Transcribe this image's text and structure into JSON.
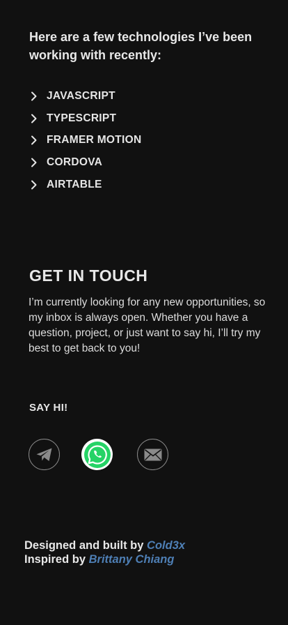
{
  "about": {
    "intro": "Here are a few technologies I’ve been working with recently:",
    "technologies": [
      "JAVASCRIPT",
      "TYPESCRIPT",
      "FRAMER MOTION",
      "CORDOVA",
      "AIRTABLE"
    ]
  },
  "contact": {
    "title": "GET IN TOUCH",
    "text": "I’m currently looking for any new opportunities, so my inbox is always open. Whether you have a question, project, or just want to say hi, I’ll try my best to get back to you!",
    "say_hi": "SAY HI!",
    "socials": [
      {
        "name": "telegram",
        "icon": "telegram-icon"
      },
      {
        "name": "whatsapp",
        "icon": "whatsapp-icon"
      },
      {
        "name": "email",
        "icon": "email-icon"
      }
    ]
  },
  "footer": {
    "designed_prefix": "Designed and built by",
    "designed_by": "Cold3x",
    "inspired_prefix": "Inspired by",
    "inspired_by": "Brittany Chiang"
  },
  "colors": {
    "background": "#111111",
    "text": "#e6e6e6",
    "link": "#4e7fb5",
    "whatsapp_green": "#25d366"
  }
}
